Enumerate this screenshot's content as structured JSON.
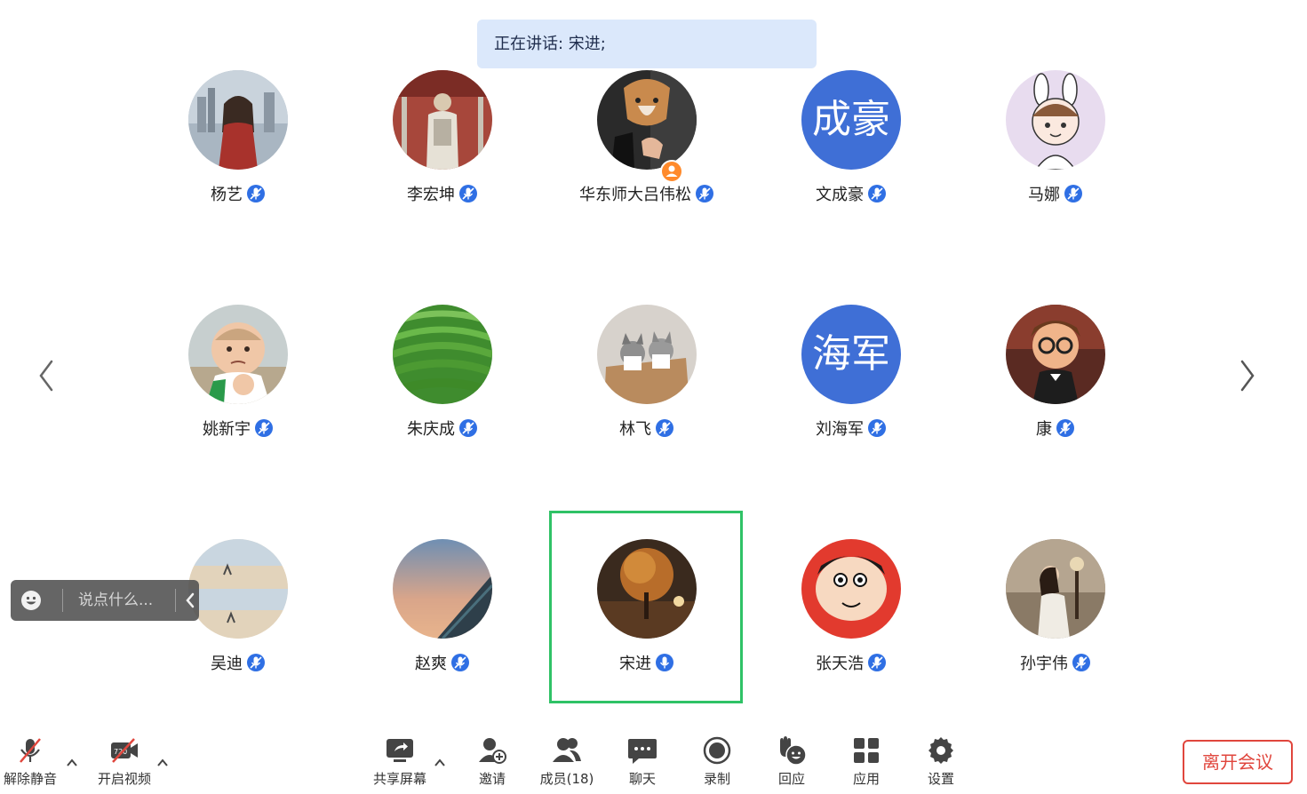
{
  "banner": {
    "speaking": "正在讲话: 宋进;"
  },
  "participants": [
    {
      "name": "杨艺"
    },
    {
      "name": "李宏坤"
    },
    {
      "name": "华东师大吕伟松"
    },
    {
      "name": "文成豪",
      "avatar_text": "成豪"
    },
    {
      "name": "马娜"
    },
    {
      "name": "姚新宇"
    },
    {
      "name": "朱庆成"
    },
    {
      "name": "林飞"
    },
    {
      "name": "刘海军",
      "avatar_text": "海军"
    },
    {
      "name": "康"
    },
    {
      "name": "吴迪"
    },
    {
      "name": "赵爽"
    },
    {
      "name": "宋进"
    },
    {
      "name": "张天浩"
    },
    {
      "name": "孙宇伟"
    }
  ],
  "chat": {
    "placeholder": "说点什么..."
  },
  "toolbar": {
    "unmute": "解除静音",
    "video": "开启视频",
    "video_badge": "720",
    "share": "共享屏幕",
    "invite": "邀请",
    "members": "成员(18)",
    "chat": "聊天",
    "record": "录制",
    "react": "回应",
    "apps": "应用",
    "settings": "设置",
    "leave": "离开会议"
  },
  "colors": {
    "accent_blue": "#2f6fe4",
    "active_green": "#2fc266",
    "leave_red": "#e0463d",
    "banner_bg": "#dbe8fb"
  }
}
